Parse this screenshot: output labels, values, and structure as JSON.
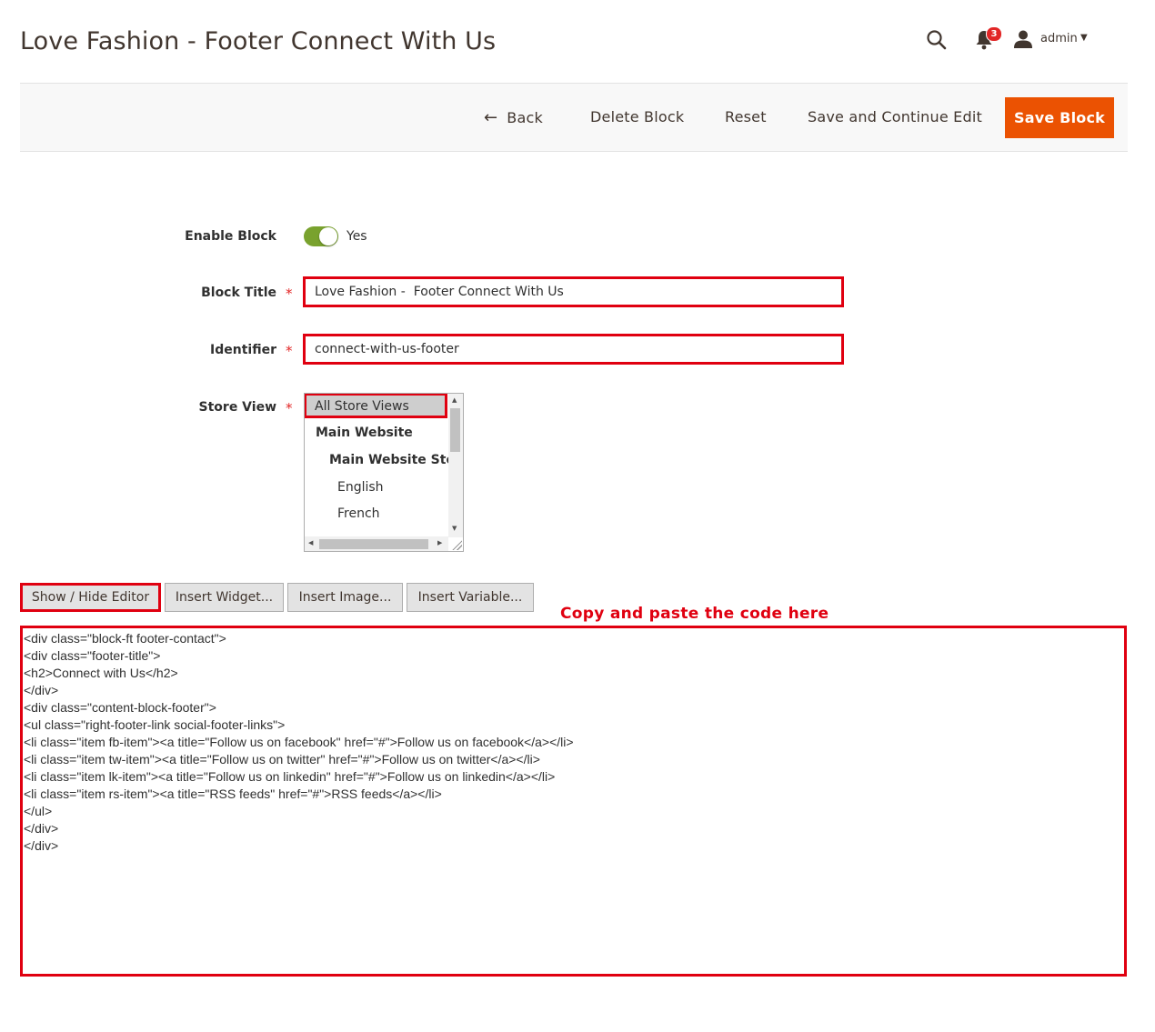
{
  "header": {
    "title": "Love Fashion - Footer Connect With Us",
    "notification_count": "3",
    "user_name": "admin"
  },
  "toolbar": {
    "back_label": "Back",
    "delete_label": "Delete Block",
    "reset_label": "Reset",
    "save_continue_label": "Save and Continue Edit",
    "save_label": "Save Block"
  },
  "form": {
    "enable_label": "Enable Block",
    "enable_value": "Yes",
    "title_label": "Block Title",
    "title_value": "Love Fashion -  Footer Connect With Us",
    "identifier_label": "Identifier",
    "identifier_value": "connect-with-us-footer",
    "store_view_label": "Store View",
    "store_options": [
      "All Store Views",
      "Main Website",
      "Main Website Store",
      "English",
      "French"
    ]
  },
  "editor": {
    "show_hide_label": "Show / Hide Editor",
    "insert_widget_label": "Insert Widget...",
    "insert_image_label": "Insert Image...",
    "insert_variable_label": "Insert Variable...",
    "note": "Copy and paste the code here",
    "content": "<div class=\"block-ft footer-contact\">\n<div class=\"footer-title\">\n<h2>Connect with Us</h2>\n</div>\n<div class=\"content-block-footer\">\n<ul class=\"right-footer-link social-footer-links\">\n<li class=\"item fb-item\"><a title=\"Follow us on facebook\" href=\"#\">Follow us on facebook</a></li>\n<li class=\"item tw-item\"><a title=\"Follow us on twitter\" href=\"#\">Follow us on twitter</a></li>\n<li class=\"item lk-item\"><a title=\"Follow us on linkedin\" href=\"#\">Follow us on linkedin</a></li>\n<li class=\"item rs-item\"><a title=\"RSS feeds\" href=\"#\">RSS feeds</a></li>\n</ul>\n</div>\n</div>"
  },
  "colors": {
    "accent_orange": "#eb5202",
    "highlight_red": "#e00010",
    "toggle_green": "#79a22e"
  }
}
